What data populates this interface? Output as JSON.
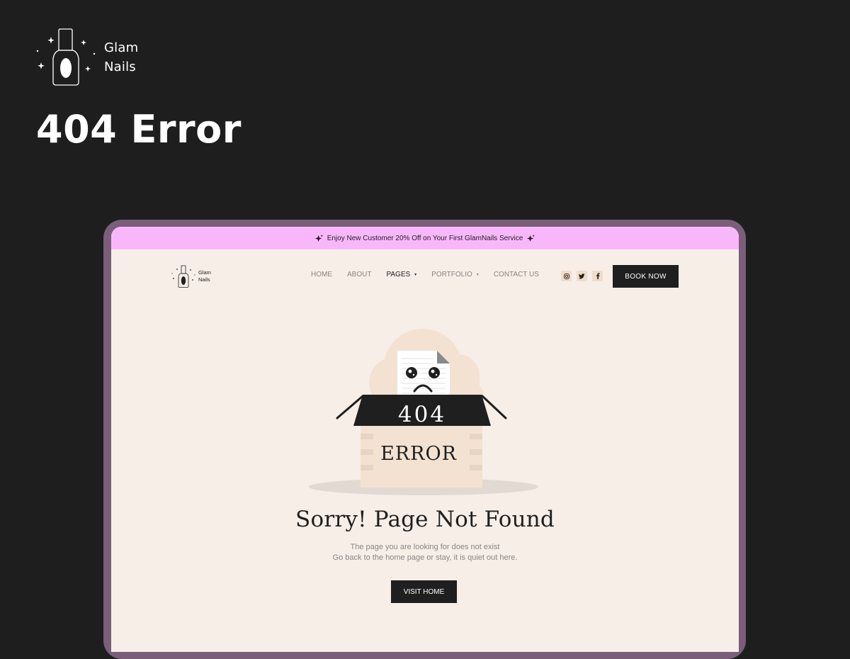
{
  "brand": {
    "name_line1": "Glam",
    "name_line2": "Nails"
  },
  "page_heading": "404 Error",
  "site": {
    "promo_text": "Enjoy New Customer 20% Off on Your First GlamNails Service",
    "logo_line1": "Glam",
    "logo_line2": "Nails",
    "menu": [
      {
        "label": "HOME",
        "dropdown": false,
        "active": false
      },
      {
        "label": "ABOUT",
        "dropdown": false,
        "active": false
      },
      {
        "label": "PAGES",
        "dropdown": true,
        "active": true
      },
      {
        "label": "PORTFOLIO",
        "dropdown": true,
        "active": false
      },
      {
        "label": "CONTACT US",
        "dropdown": false,
        "active": false
      }
    ],
    "social": [
      {
        "icon": "instagram-icon",
        "glyph": "◎"
      },
      {
        "icon": "twitter-icon",
        "glyph": "✔"
      },
      {
        "icon": "facebook-icon",
        "glyph": "f"
      }
    ],
    "book_button": "BOOK NOW",
    "illustration": {
      "box_number": "404",
      "box_label": "ERROR"
    },
    "error_title": "Sorry! Page Not Found",
    "error_line1": "The page you are looking for does not exist",
    "error_line2": "Go back to the home page or stay, it is quiet out here.",
    "visit_button": "VISIT HOME"
  },
  "colors": {
    "background": "#1e1e1f",
    "device_frame": "#7a5e7a",
    "screen_bg": "#f7eee8",
    "promo_bar": "#f9b7fb",
    "dark": "#1f1f1f",
    "box_tan": "#f3e2d2",
    "social_bg": "#f0dccb"
  }
}
